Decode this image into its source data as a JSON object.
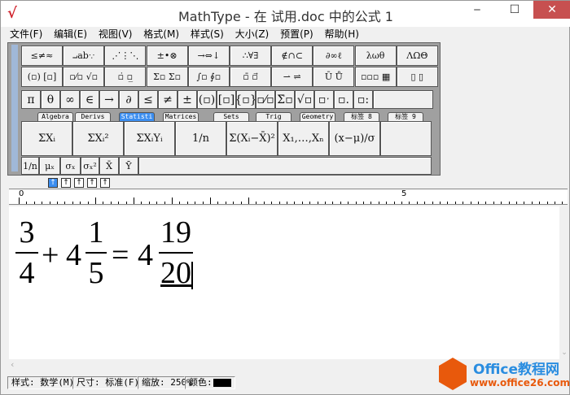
{
  "window": {
    "title": "MathType - 在 试用.doc 中的公式 1",
    "minimize": "‒",
    "maximize": "☐",
    "close": "✕"
  },
  "menu": [
    "文件(F)",
    "编辑(E)",
    "视图(V)",
    "格式(M)",
    "样式(S)",
    "大小(Z)",
    "预置(P)",
    "帮助(H)"
  ],
  "palette_row1": [
    "≤≠≈",
    "⨼ab∵",
    "⋰⋮⋱",
    "±•⊗",
    "→⇔↓",
    "∴∀∃",
    "∉∩⊂",
    "∂∞ℓ",
    "λωθ",
    "ΛΩΘ"
  ],
  "palette_row2": [
    "(▫) [▫]",
    "▫⁄▫ √▫",
    "▫̇ ▫̲",
    "Σ▫ Σ▫",
    "∫▫ ∮▫",
    "▫̄ ▫⃗",
    "⇀ ⇌",
    "Ū Ů",
    "▫▫▫ ▦",
    "▯ ▯"
  ],
  "symbol_bar": [
    "π",
    "θ",
    "∞",
    "∈",
    "→",
    "∂",
    "≤",
    "≠",
    "±",
    "(▫)",
    "[▫]",
    "{▫}",
    "▫⁄▫",
    "Σ̇▫",
    "√▫",
    "▫ˑ",
    "▫.",
    "▫:"
  ],
  "tabs": [
    {
      "label": "Algebra"
    },
    {
      "label": "Derivs"
    },
    {
      "label": "Statisti",
      "active": true
    },
    {
      "label": "Matrices"
    },
    {
      "label": "Sets"
    },
    {
      "label": "Trig"
    },
    {
      "label": "Geometry"
    },
    {
      "label": "标签 8"
    },
    {
      "label": "标签 9"
    }
  ],
  "templates": [
    "ΣXᵢ",
    "ΣXᵢ²",
    "ΣXᵢYᵢ",
    "1/n",
    "Σ(Xᵢ−X̄)²",
    "X₁,…,Xₙ",
    "(x−μ)/σ",
    ""
  ],
  "templates_small": [
    "1/n",
    "μₓ",
    "σₓ",
    "σₓ²",
    "X̄",
    "Ȳ"
  ],
  "nudges": [
    "↑",
    "↑",
    "↑",
    "↑",
    "↑"
  ],
  "ruler": {
    "start": "0",
    "mid": "5"
  },
  "equation": {
    "f1_num": "3",
    "f1_den": "4",
    "plus": "+",
    "whole1": "4",
    "f2_num": "1",
    "f2_den": "5",
    "equals": "=",
    "whole2": "4",
    "f3_num": "19",
    "f3_den": "20"
  },
  "status": {
    "style": "样式: 数学(M)",
    "size": "尺寸: 标准(F)",
    "zoom": "缩放: 250%",
    "color_label": "颜色:",
    "color_value": "#000000"
  },
  "watermark": {
    "brand": "Office教程网",
    "url": "www.office26.com"
  }
}
